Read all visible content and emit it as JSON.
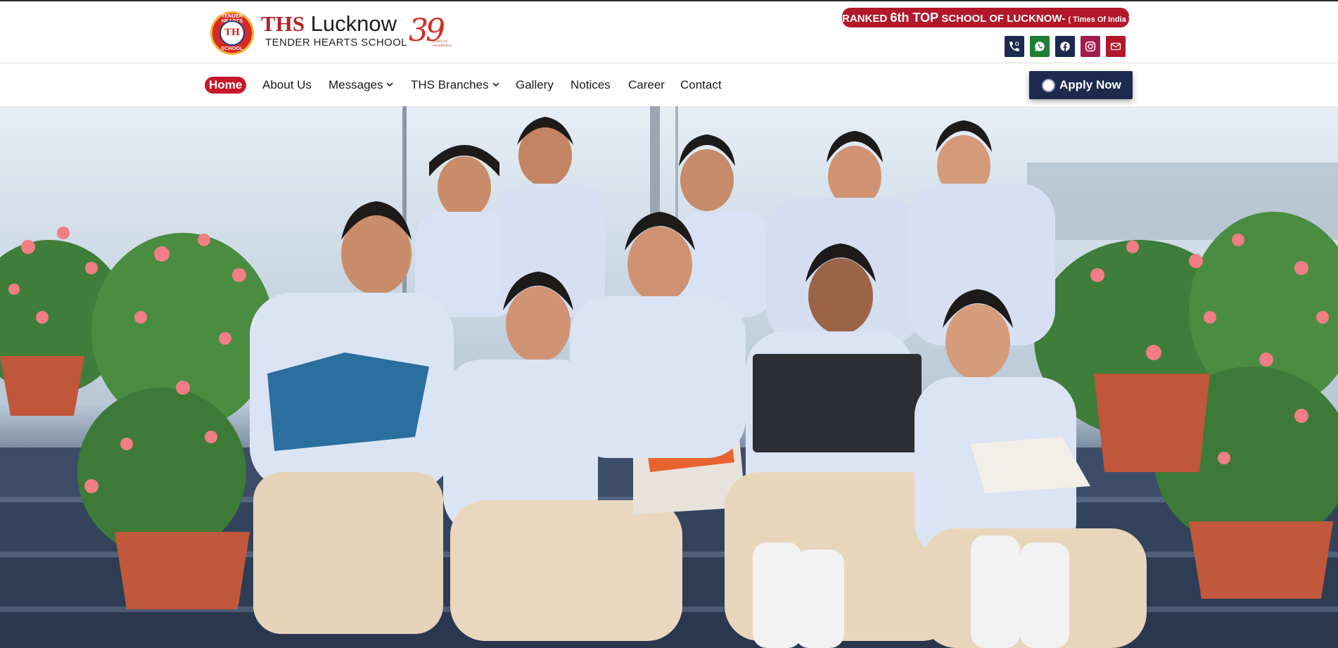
{
  "header": {
    "brand_ths": "THS",
    "brand_city": " Lucknow",
    "brand_sub": "TENDER HEARTS SCHOOL",
    "logo_top_text": "TENDER HEARTS",
    "logo_bottom_text": "SCHOOL",
    "logo_monogram": "TH",
    "years": "39",
    "years_caption": "years of excellence",
    "ranked_pre": "RANKED ",
    "ranked_big": "6th TOP",
    "ranked_mid": " SCHOOL OF LUCKNOW- ",
    "ranked_small": "( Times Of India )"
  },
  "social": [
    {
      "icon": "phone-icon",
      "color": "#1c2a4e"
    },
    {
      "icon": "whatsapp-icon",
      "color": "#1e7e34"
    },
    {
      "icon": "facebook-icon",
      "color": "#1c2a4e"
    },
    {
      "icon": "instagram-icon",
      "color": "#a21c4f"
    },
    {
      "icon": "mail-icon",
      "color": "#b3172a"
    }
  ],
  "nav": {
    "items": [
      {
        "label": "Home",
        "active": true
      },
      {
        "label": "About Us"
      },
      {
        "label": "Messages",
        "dropdown": true
      },
      {
        "label": "THS Branches",
        "dropdown": true
      },
      {
        "label": "Gallery"
      },
      {
        "label": "Notices"
      },
      {
        "label": "Career"
      },
      {
        "label": "Contact"
      }
    ],
    "apply_label": "Apply Now"
  },
  "colors": {
    "brand_red": "#b3172a",
    "navy": "#1c2a4e"
  }
}
